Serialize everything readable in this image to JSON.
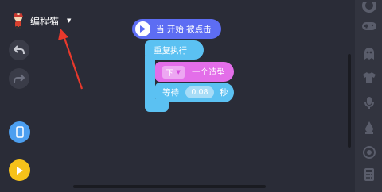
{
  "sprite": {
    "name": "编程猫"
  },
  "toolbar": {
    "undo_icon": "undo-icon",
    "redo_icon": "redo-icon",
    "device_icon": "phone-icon",
    "run_icon": "play-icon"
  },
  "blocks": {
    "hat": {
      "label": "当 开始 被点击"
    },
    "repeat": {
      "label": "重复执行"
    },
    "costume": {
      "direction": "下",
      "label": "一个造型"
    },
    "wait": {
      "label": "等待",
      "value": "0.08",
      "unit": "秒"
    }
  },
  "palette": {
    "icons": [
      "gear-icon",
      "gamepad-icon",
      "ghost-icon",
      "shirt-icon",
      "microphone-icon",
      "drop-icon",
      "target-icon",
      "calculator-icon"
    ]
  },
  "colors": {
    "background": "#2a2c37",
    "event_block": "#5d6df3",
    "control_block": "#5bc1f2",
    "appearance_block": "#e36ee9",
    "device_button": "#4c9ff0",
    "run_button": "#f6c21a",
    "annotation_arrow": "#e8392c"
  }
}
